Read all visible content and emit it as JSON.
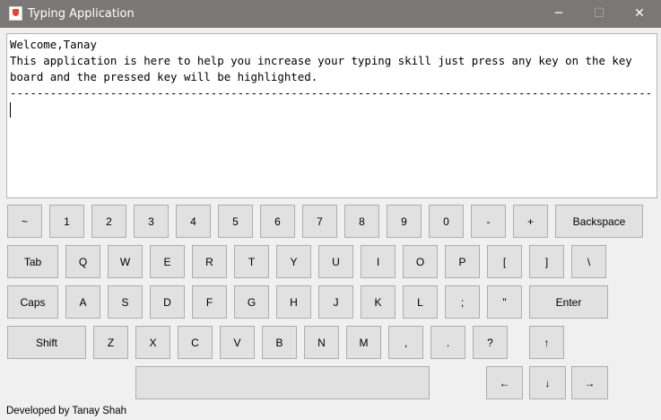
{
  "window": {
    "title": "Typing Application",
    "minimize": "─",
    "maximize": "☐",
    "close": "✕"
  },
  "textarea": {
    "greeting": "Welcome,Tanay",
    "instructions": "This application is here to help you increase your typing skill just press any key on the key board and the pressed key will be highlighted.",
    "separator": "-----------------------------------------------------------------------------------------------------"
  },
  "keyboard": {
    "row1": [
      "~",
      "1",
      "2",
      "3",
      "4",
      "5",
      "6",
      "7",
      "8",
      "9",
      "0",
      "-",
      "+",
      "Backspace"
    ],
    "row2": [
      "Tab",
      "Q",
      "W",
      "E",
      "R",
      "T",
      "Y",
      "U",
      "I",
      "O",
      "P",
      "[",
      "]",
      "\\"
    ],
    "row3": [
      "Caps",
      "A",
      "S",
      "D",
      "F",
      "G",
      "H",
      "J",
      "K",
      "L",
      ";",
      "\"",
      "Enter"
    ],
    "row4": [
      "Shift",
      "Z",
      "X",
      "C",
      "V",
      "B",
      "N",
      "M",
      ",",
      ".",
      "?",
      "↑"
    ],
    "row5": [
      "",
      "←",
      "↓",
      "→"
    ]
  },
  "footer": "Developed by Tanay Shah"
}
